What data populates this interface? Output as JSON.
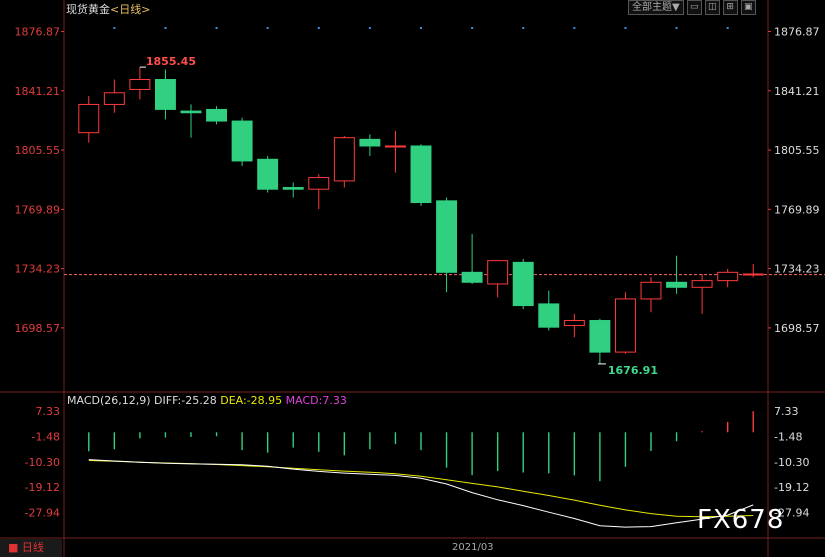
{
  "header": {
    "instrument": "现货黄金",
    "timeframe": "<日线>"
  },
  "toolbar": {
    "theme_button": "全部主题▼"
  },
  "macd_header": {
    "label": "MACD(26,12,9)",
    "diff": "DIFF:-25.28",
    "dea": "DEA:-28.95",
    "macd": "MACD:7.33"
  },
  "bottom": {
    "tab": "日线",
    "date": "2021/03"
  },
  "watermark": "FX678",
  "colors": {
    "up": "#ff3b3b",
    "down": "#30d080",
    "diff": "#ffffff",
    "dea": "#e8e800",
    "macd": "#e040e0",
    "price_line": "#ff6464",
    "axis": "#e03c3c"
  },
  "chart_data": [
    {
      "type": "candlestick",
      "ylim": [
        1660,
        1885
      ],
      "y_ticks": [
        1876.87,
        1841.21,
        1805.55,
        1769.89,
        1734.23,
        1698.57
      ],
      "current_price_line": 1730.6,
      "annotations": [
        {
          "text": "1855.45",
          "index": 2,
          "value": 1855.45,
          "kind": "high"
        },
        {
          "text": "1676.91",
          "index": 20,
          "value": 1676.91,
          "kind": "low"
        }
      ],
      "candles": [
        {
          "o": 1816,
          "h": 1838,
          "l": 1810,
          "c": 1833
        },
        {
          "o": 1833,
          "h": 1848,
          "l": 1828,
          "c": 1840
        },
        {
          "o": 1842,
          "h": 1855.45,
          "l": 1836,
          "c": 1848
        },
        {
          "o": 1848,
          "h": 1854,
          "l": 1824,
          "c": 1830
        },
        {
          "o": 1829,
          "h": 1833,
          "l": 1813,
          "c": 1828
        },
        {
          "o": 1830,
          "h": 1832,
          "l": 1821,
          "c": 1823
        },
        {
          "o": 1823,
          "h": 1825,
          "l": 1796,
          "c": 1799
        },
        {
          "o": 1800,
          "h": 1802,
          "l": 1780,
          "c": 1782
        },
        {
          "o": 1783,
          "h": 1786,
          "l": 1777,
          "c": 1782
        },
        {
          "o": 1782,
          "h": 1791,
          "l": 1770,
          "c": 1789
        },
        {
          "o": 1787,
          "h": 1814,
          "l": 1783,
          "c": 1813
        },
        {
          "o": 1812,
          "h": 1815,
          "l": 1802,
          "c": 1808
        },
        {
          "o": 1808,
          "h": 1817,
          "l": 1792,
          "c": 1808
        },
        {
          "o": 1808,
          "h": 1809,
          "l": 1772,
          "c": 1774
        },
        {
          "o": 1775,
          "h": 1777,
          "l": 1720,
          "c": 1732
        },
        {
          "o": 1732,
          "h": 1755,
          "l": 1725,
          "c": 1726
        },
        {
          "o": 1725,
          "h": 1738,
          "l": 1717,
          "c": 1739
        },
        {
          "o": 1738,
          "h": 1740,
          "l": 1710,
          "c": 1712
        },
        {
          "o": 1713,
          "h": 1721,
          "l": 1697,
          "c": 1699
        },
        {
          "o": 1700,
          "h": 1707,
          "l": 1693,
          "c": 1703
        },
        {
          "o": 1703,
          "h": 1704,
          "l": 1676.91,
          "c": 1684
        },
        {
          "o": 1684,
          "h": 1720,
          "l": 1683,
          "c": 1716
        },
        {
          "o": 1716,
          "h": 1729,
          "l": 1708,
          "c": 1726
        },
        {
          "o": 1726,
          "h": 1742,
          "l": 1719,
          "c": 1723
        },
        {
          "o": 1723,
          "h": 1731,
          "l": 1707,
          "c": 1727
        },
        {
          "o": 1727,
          "h": 1734,
          "l": 1723,
          "c": 1732
        },
        {
          "o": 1731,
          "h": 1737,
          "l": 1729,
          "c": 1731
        }
      ]
    },
    {
      "type": "macd",
      "ylim": [
        -34,
        9.5
      ],
      "y_ticks": [
        7.33,
        -1.48,
        -10.3,
        -19.12,
        -27.94
      ],
      "diff": [
        -9.5,
        -10.0,
        -10.4,
        -10.8,
        -11.0,
        -11.1,
        -11.3,
        -11.8,
        -12.8,
        -13.6,
        -14.2,
        -14.6,
        -15.0,
        -16.0,
        -18.0,
        -21.0,
        -23.5,
        -25.5,
        -27.8,
        -30.0,
        -32.5,
        -33.0,
        -32.8,
        -31.5,
        -30.2,
        -28.8,
        -25.28
      ],
      "dea": [
        -9.8,
        -10.1,
        -10.4,
        -10.7,
        -10.9,
        -11.2,
        -11.6,
        -12.0,
        -12.5,
        -13.0,
        -13.5,
        -13.9,
        -14.4,
        -15.3,
        -16.5,
        -17.8,
        -19.0,
        -20.5,
        -22.0,
        -23.6,
        -25.4,
        -27.0,
        -28.3,
        -29.2,
        -29.4,
        -29.2,
        -28.95
      ],
      "histogram": [
        -6.6,
        -5.9,
        -2.1,
        -1.8,
        -1.6,
        -1.4,
        -6.2,
        -7.1,
        -5.3,
        -6.8,
        -8.0,
        -5.9,
        -4.1,
        -6.2,
        -12.3,
        -14.9,
        -13.5,
        -14.0,
        -14.3,
        -15.0,
        -17.0,
        -12.0,
        -6.5,
        -3.1,
        0.4,
        3.6,
        7.33
      ]
    }
  ]
}
